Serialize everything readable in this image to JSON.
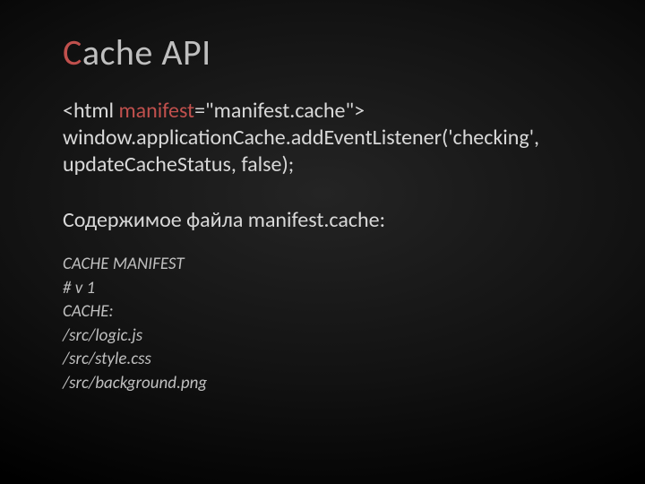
{
  "title": {
    "initial": "C",
    "rest": "ache API"
  },
  "code": {
    "tag_open": "<html ",
    "attr_name": "manifest",
    "attr_rest": "=\"manifest.cache\">",
    "js_line1_a": "window.applicationCache.addEventListener('checking',",
    "js_line2": "updateCacheStatus, false);"
  },
  "subhead": {
    "prefix": "Содержимое файла ",
    "filename": "manifest.cache",
    "suffix": ":"
  },
  "manifest": [
    "CACHE MANIFEST",
    "# v 1",
    "CACHE:",
    "/src/logic.js",
    "/src/style.css",
    "/src/background.png"
  ]
}
